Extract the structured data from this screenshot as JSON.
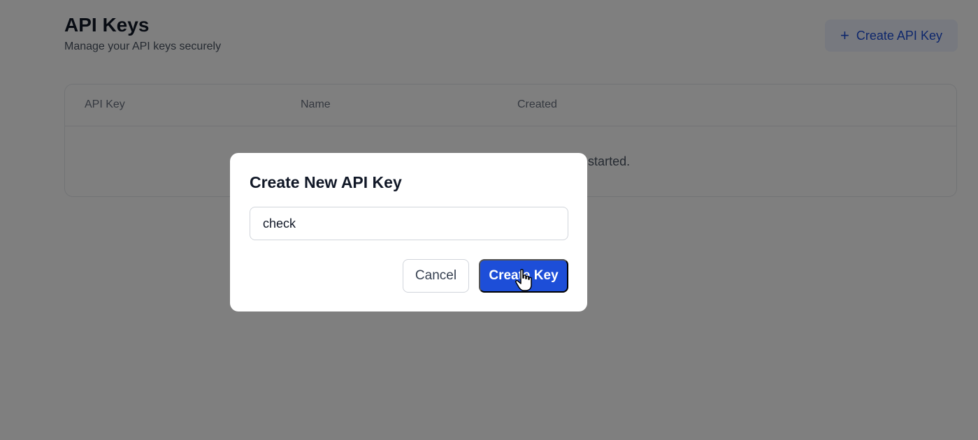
{
  "page": {
    "title": "API Keys",
    "subtitle": "Manage your API keys securely"
  },
  "header_action": {
    "icon": "plus-icon",
    "label": "Create API Key"
  },
  "table": {
    "columns": [
      "API Key",
      "Name",
      "Created"
    ],
    "empty_message": "No API keys yet. Create one to get started."
  },
  "modal": {
    "title": "Create New API Key",
    "input_value": "check",
    "cancel_label": "Cancel",
    "submit_label": "Create Key"
  },
  "colors": {
    "accent": "#1d4ed8",
    "overlay": "rgba(0,0,0,0.5)"
  }
}
